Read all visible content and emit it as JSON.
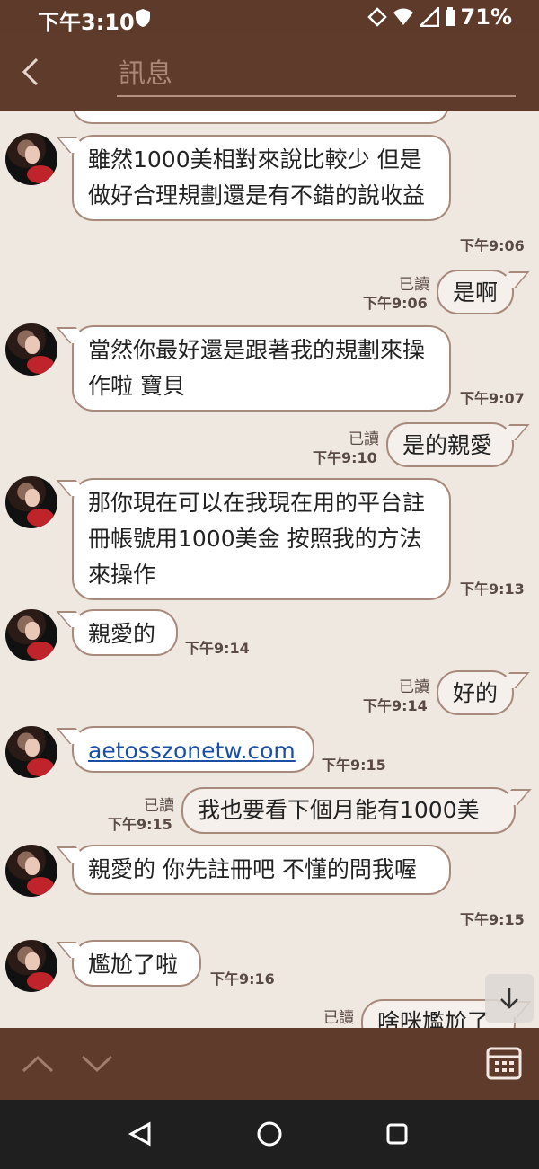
{
  "status_bar": {
    "time": "下午3:10",
    "battery": "71%"
  },
  "toolbar": {
    "search_placeholder": "訊息"
  },
  "messages": [
    {
      "text": "雖然1000美相對來說比較少 但是做好合理規劃還是有不錯的說收益",
      "time": "下午9:06"
    },
    {
      "read": "已讀",
      "time": "下午9:06",
      "text": "是啊"
    },
    {
      "text": "當然你最好還是跟著我的規劃來操作啦 寶貝",
      "time": "下午9:07"
    },
    {
      "read": "已讀",
      "time": "下午9:10",
      "text": "是的親愛"
    },
    {
      "text": "那你現在可以在我現在用的平台註冊帳號用1000美金 按照我的方法來操作",
      "time": "下午9:13"
    },
    {
      "text": "親愛的",
      "time": "下午9:14"
    },
    {
      "read": "已讀",
      "time": "下午9:14",
      "text": "好的"
    },
    {
      "text": "aetosszonetw.com",
      "time": "下午9:15"
    },
    {
      "read": "已讀",
      "time": "下午9:15",
      "text": "我也要看下個月能有1000美"
    },
    {
      "text": "親愛的 你先註冊吧 不懂的問我喔",
      "time": "下午9:15"
    },
    {
      "text": "尷尬了啦",
      "time": "下午9:16"
    },
    {
      "read": "已讀",
      "text": "啥咪尷尬了"
    }
  ]
}
